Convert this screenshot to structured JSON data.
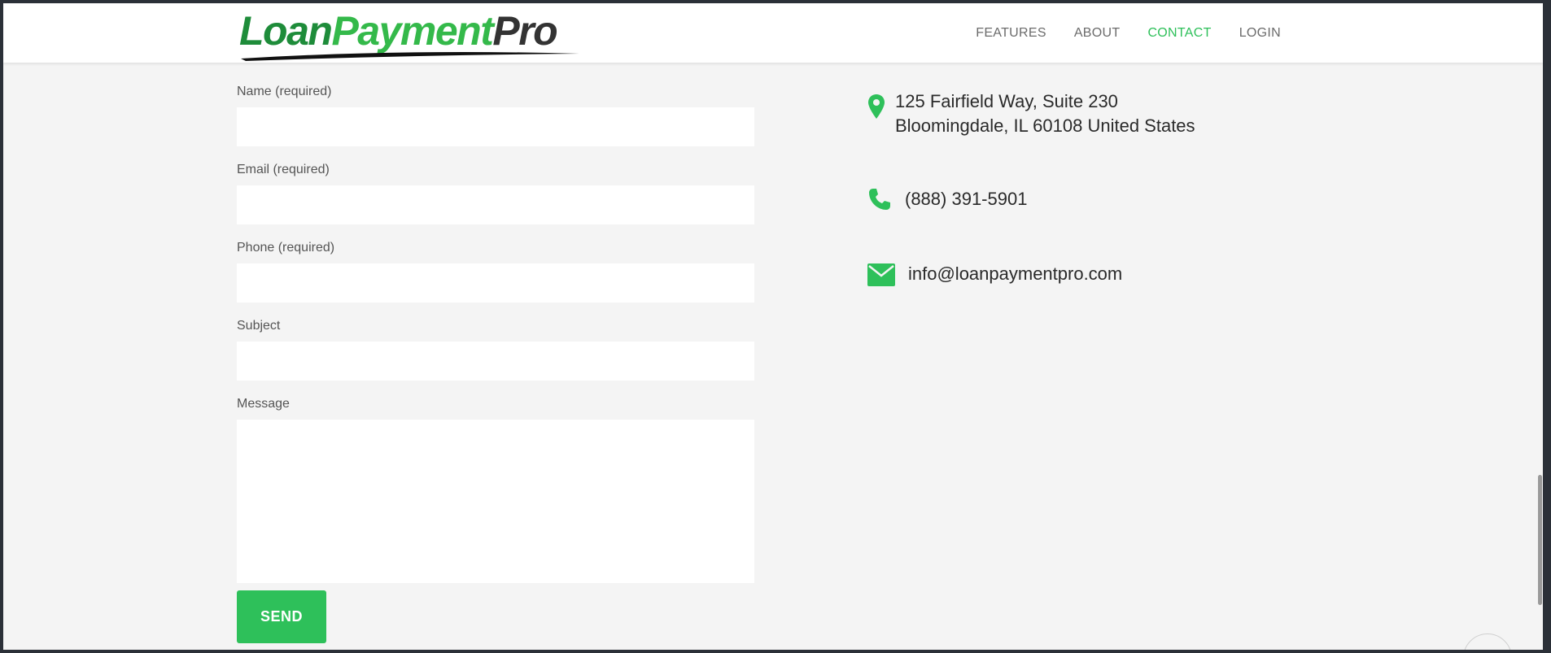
{
  "brand": {
    "logo_part1": "Loan",
    "logo_part2": "Payment",
    "logo_part3": "Pro",
    "colors": {
      "dark_green": "#1e8c3a",
      "green": "#34b94a",
      "accent": "#2ec05a",
      "dark": "#333333"
    }
  },
  "nav": {
    "items": [
      {
        "label": "FEATURES",
        "active": false
      },
      {
        "label": "ABOUT",
        "active": false
      },
      {
        "label": "CONTACT",
        "active": true
      },
      {
        "label": "LOGIN",
        "active": false
      }
    ]
  },
  "form": {
    "name_label": "Name (required)",
    "name_value": "",
    "email_label": "Email (required)",
    "email_value": "",
    "phone_label": "Phone (required)",
    "phone_value": "",
    "subject_label": "Subject",
    "subject_value": "",
    "message_label": "Message",
    "message_value": "",
    "send_label": "SEND"
  },
  "contact": {
    "address_line1": "125 Fairfield Way, Suite 230",
    "address_line2": "Bloomingdale, IL 60108 United States",
    "address_icon": "map-marker-icon",
    "phone": "(888) 391-5901",
    "phone_icon": "phone-icon",
    "email": "info@loanpaymentpro.com",
    "email_icon": "envelope-icon"
  }
}
